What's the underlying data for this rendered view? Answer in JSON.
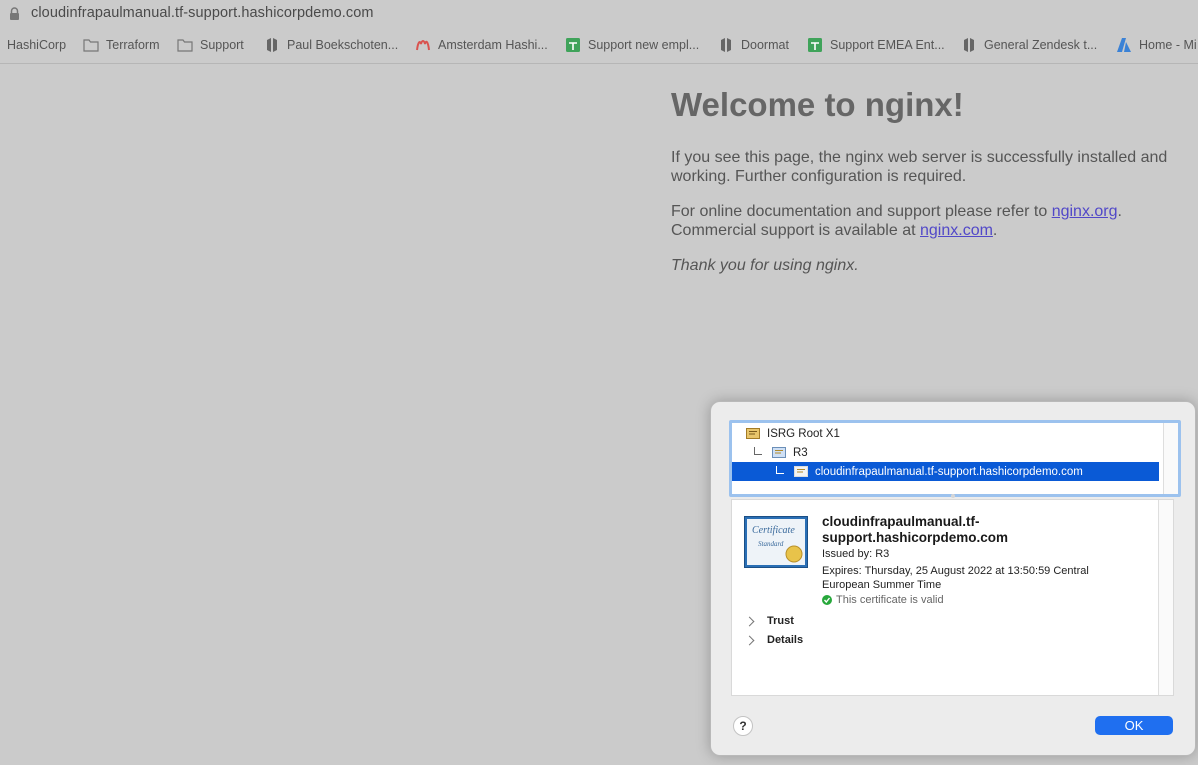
{
  "browser": {
    "url": "cloudinfrapaulmanual.tf-support.hashicorpdemo.com",
    "bookmarks": [
      {
        "label": "HashiCorp",
        "icon": "none"
      },
      {
        "label": "Terraform",
        "icon": "folder-icon"
      },
      {
        "label": "Support",
        "icon": "folder-icon"
      },
      {
        "label": "Paul Boekschoten...",
        "icon": "hashicorp-icon"
      },
      {
        "label": "Amsterdam Hashi...",
        "icon": "meetup-icon"
      },
      {
        "label": "Support new empl...",
        "icon": "sheets-icon"
      },
      {
        "label": "Doormat",
        "icon": "hashicorp-icon"
      },
      {
        "label": "Support EMEA Ent...",
        "icon": "sheets-icon"
      },
      {
        "label": "General Zendesk t...",
        "icon": "hashicorp-icon"
      },
      {
        "label": "Home - Mi",
        "icon": "azure-icon"
      }
    ]
  },
  "page": {
    "title": "Welcome to nginx!",
    "p1": "If you see this page, the nginx web server is successfully installed and working. Further configuration is required.",
    "p2_before": "For online documentation and support please refer to ",
    "link1": "nginx.org",
    "p2_mid": ".",
    "p2_line2": "Commercial support is available at ",
    "link2": "nginx.com",
    "p2_end": ".",
    "p3": "Thank you for using nginx."
  },
  "dialog": {
    "chain": [
      {
        "label": "ISRG Root X1"
      },
      {
        "label": "R3"
      },
      {
        "label": "cloudinfrapaulmanual.tf-support.hashicorpdemo.com"
      }
    ],
    "common_name": "cloudinfrapaulmanual.tf-support.hashicorpdemo.com",
    "cn_line1": "cloudinfrapaulmanual.tf-",
    "cn_line2": "support.hashicorpdemo.com",
    "issued_by": "Issued by: R3",
    "expires": "Expires: Thursday, 25 August 2022 at 13:50:59 Central European Summer Time",
    "valid": "This certificate is valid",
    "sections": [
      "Trust",
      "Details"
    ],
    "help": "?",
    "ok": "OK",
    "colors": {
      "selection": "#0a5ad6",
      "ok_button": "#1f6ff0",
      "valid": "#27a83b"
    }
  }
}
